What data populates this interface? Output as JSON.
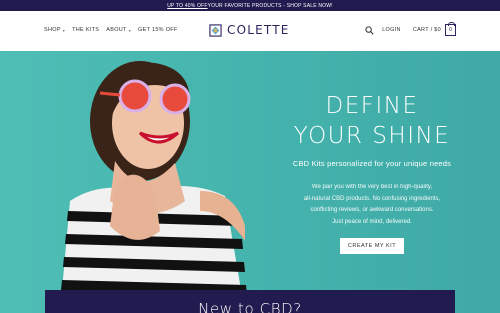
{
  "announcement": {
    "link_text": "UP TO 40% OFF",
    "rest_text": " YOUR FAVORITE PRODUCTS - SHOP SALE NOW!"
  },
  "nav": {
    "left": [
      {
        "label": "SHOP",
        "has_dropdown": true
      },
      {
        "label": "THE KITS",
        "has_dropdown": false
      },
      {
        "label": "ABOUT",
        "has_dropdown": true
      },
      {
        "label": "GET 15% OFF",
        "has_dropdown": false
      }
    ],
    "login": "LOGIN",
    "cart_label": "CART / $0",
    "cart_count": "0"
  },
  "brand": {
    "name": "COLETTE",
    "color": "#2c2660"
  },
  "hero": {
    "headline_line1": "DEFINE",
    "headline_line2": "YOUR SHINE",
    "subhead": "CBD Kits personalized for your unique needs",
    "body_lines": [
      "We pair you with the very best in high-quality,",
      "all-natural CBD products. No confusing ingredients,",
      "conflicting reviews, or awkward conversations.",
      "Just peace of mind, delivered."
    ],
    "cta": "CREATE MY KIT",
    "background": "#46b5ae"
  },
  "teaser": {
    "title": "New to CBD?"
  }
}
